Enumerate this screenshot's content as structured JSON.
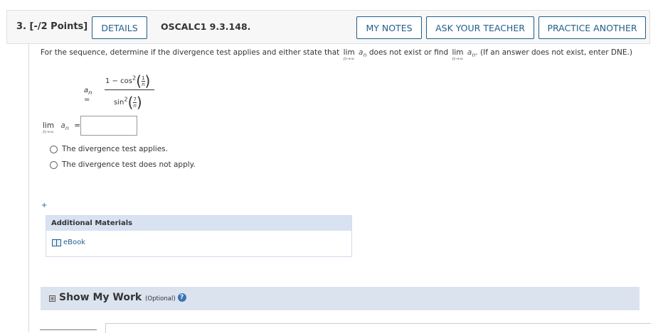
{
  "header": {
    "question_number": "3. [-/2 Points]",
    "details_label": "DETAILS",
    "problem_code": "OSCALC1 9.3.148.",
    "my_notes_label": "MY NOTES",
    "ask_teacher_label": "ASK YOUR TEACHER",
    "practice_another_label": "PRACTICE ANOTHER"
  },
  "question": {
    "prompt_before": "For the sequence, determine if the divergence test applies and either state that",
    "lim": "lim",
    "lim_sub": "n→∞",
    "a": "a",
    "n": "n",
    "prompt_middle": "does not exist or find",
    "prompt_after": ". (If an answer does not exist, enter DNE.)",
    "formula": {
      "lhs": "a",
      "lhs_sub": "n",
      "equals": "=",
      "numerator_prefix": "1 − cos",
      "numerator_exp": "2",
      "numerator_frac_top": "1",
      "numerator_frac_bottom": "n",
      "denominator_prefix": "sin",
      "denominator_exp": "2",
      "denominator_frac_top": "7",
      "denominator_frac_bottom": "n"
    },
    "answer_label_lim": "lim",
    "answer_label_sub": "n→∞",
    "answer_label_a": "a",
    "answer_label_n": "n",
    "answer_label_eq": "=",
    "answer_value": "",
    "option_1": "The divergence test applies.",
    "option_2": "The divergence test does not apply."
  },
  "plus_symbol": "+",
  "additional_materials": {
    "title": "Additional Materials",
    "ebook_label": "eBook"
  },
  "show_work": {
    "expand_symbol": "⊞",
    "label": "Show My Work",
    "optional": "(Optional)",
    "help_symbol": "?"
  },
  "colors": {
    "accent": "#1f5f8b",
    "panel": "#dbe3ef"
  }
}
